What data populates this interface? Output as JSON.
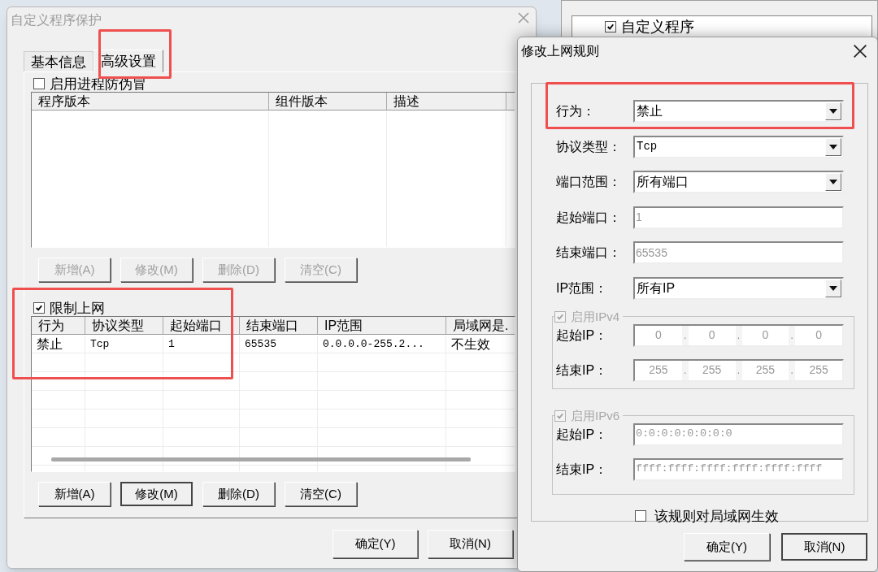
{
  "background_window": {
    "tree_items": [
      {
        "label": "自定义程序",
        "checked": true
      }
    ]
  },
  "main_window": {
    "title": "自定义程序保护",
    "tabs": [
      {
        "label": "基本信息",
        "selected": false,
        "highlighted": false
      },
      {
        "label": "高级设置",
        "selected": true,
        "highlighted": true
      }
    ],
    "anti_spoof": {
      "label": "启用进程防伪冒",
      "checked": false,
      "highlighted": false,
      "columns": [
        "程序版本",
        "组件版本",
        "描述"
      ],
      "buttons": [
        {
          "label": "新增(A)",
          "disabled": true,
          "focused": false
        },
        {
          "label": "修改(M)",
          "disabled": true,
          "focused": false
        },
        {
          "label": "删除(D)",
          "disabled": true,
          "focused": false
        },
        {
          "label": "清空(C)",
          "disabled": true,
          "focused": false
        }
      ]
    },
    "network_limit": {
      "label": "限制上网",
      "checked": true,
      "highlighted": true,
      "columns": [
        "行为",
        "协议类型",
        "起始端口",
        "结束端口",
        "IP范围",
        "局域网是."
      ],
      "rows": [
        [
          "禁止",
          "Tcp",
          "1",
          "65535",
          "0.0.0.0-255.2...",
          "不生效"
        ]
      ],
      "buttons": [
        {
          "label": "新增(A)",
          "disabled": false,
          "focused": false
        },
        {
          "label": "修改(M)",
          "disabled": false,
          "focused": true
        },
        {
          "label": "删除(D)",
          "disabled": false,
          "focused": false
        },
        {
          "label": "清空(C)",
          "disabled": false,
          "focused": false
        }
      ]
    },
    "footer_buttons": [
      {
        "label": "确定(Y)"
      },
      {
        "label": "取消(N)"
      }
    ]
  },
  "dialog": {
    "title": "修改上网规则",
    "fields": [
      {
        "kind": "select",
        "label": "行为：",
        "value": "禁止",
        "disabled": false,
        "highlighted": true
      },
      {
        "kind": "select",
        "label": "协议类型：",
        "value": "Tcp",
        "disabled": false,
        "highlighted": false
      },
      {
        "kind": "select",
        "label": "端口范围：",
        "value": "所有端口",
        "disabled": false,
        "highlighted": false
      },
      {
        "kind": "text",
        "label": "起始端口：",
        "value": "1",
        "disabled": true,
        "highlighted": false
      },
      {
        "kind": "text",
        "label": "结束端口：",
        "value": "65535",
        "disabled": true,
        "highlighted": false
      },
      {
        "kind": "select",
        "label": "IP范围：",
        "value": "所有IP",
        "disabled": false,
        "highlighted": false
      }
    ],
    "ipv4": {
      "label": "启用IPv4",
      "checked": true,
      "disabled": true,
      "separator": ".",
      "rows": [
        {
          "label": "起始IP：",
          "octets": [
            "0",
            "0",
            "0",
            "0"
          ]
        },
        {
          "label": "结束IP：",
          "octets": [
            "255",
            "255",
            "255",
            "255"
          ]
        }
      ]
    },
    "ipv6": {
      "label": "启用IPv6",
      "checked": true,
      "disabled": true,
      "rows": [
        {
          "label": "起始IP：",
          "value": "0:0:0:0:0:0:0:0"
        },
        {
          "label": "结束IP：",
          "value": "ffff:ffff:ffff:ffff:ffff:ffff"
        }
      ]
    },
    "lan_option": {
      "label": "该规则对局域网生效",
      "checked": false
    },
    "buttons": [
      {
        "label": "确定(Y)",
        "focused": false
      },
      {
        "label": "取消(N)",
        "focused": true
      }
    ]
  }
}
